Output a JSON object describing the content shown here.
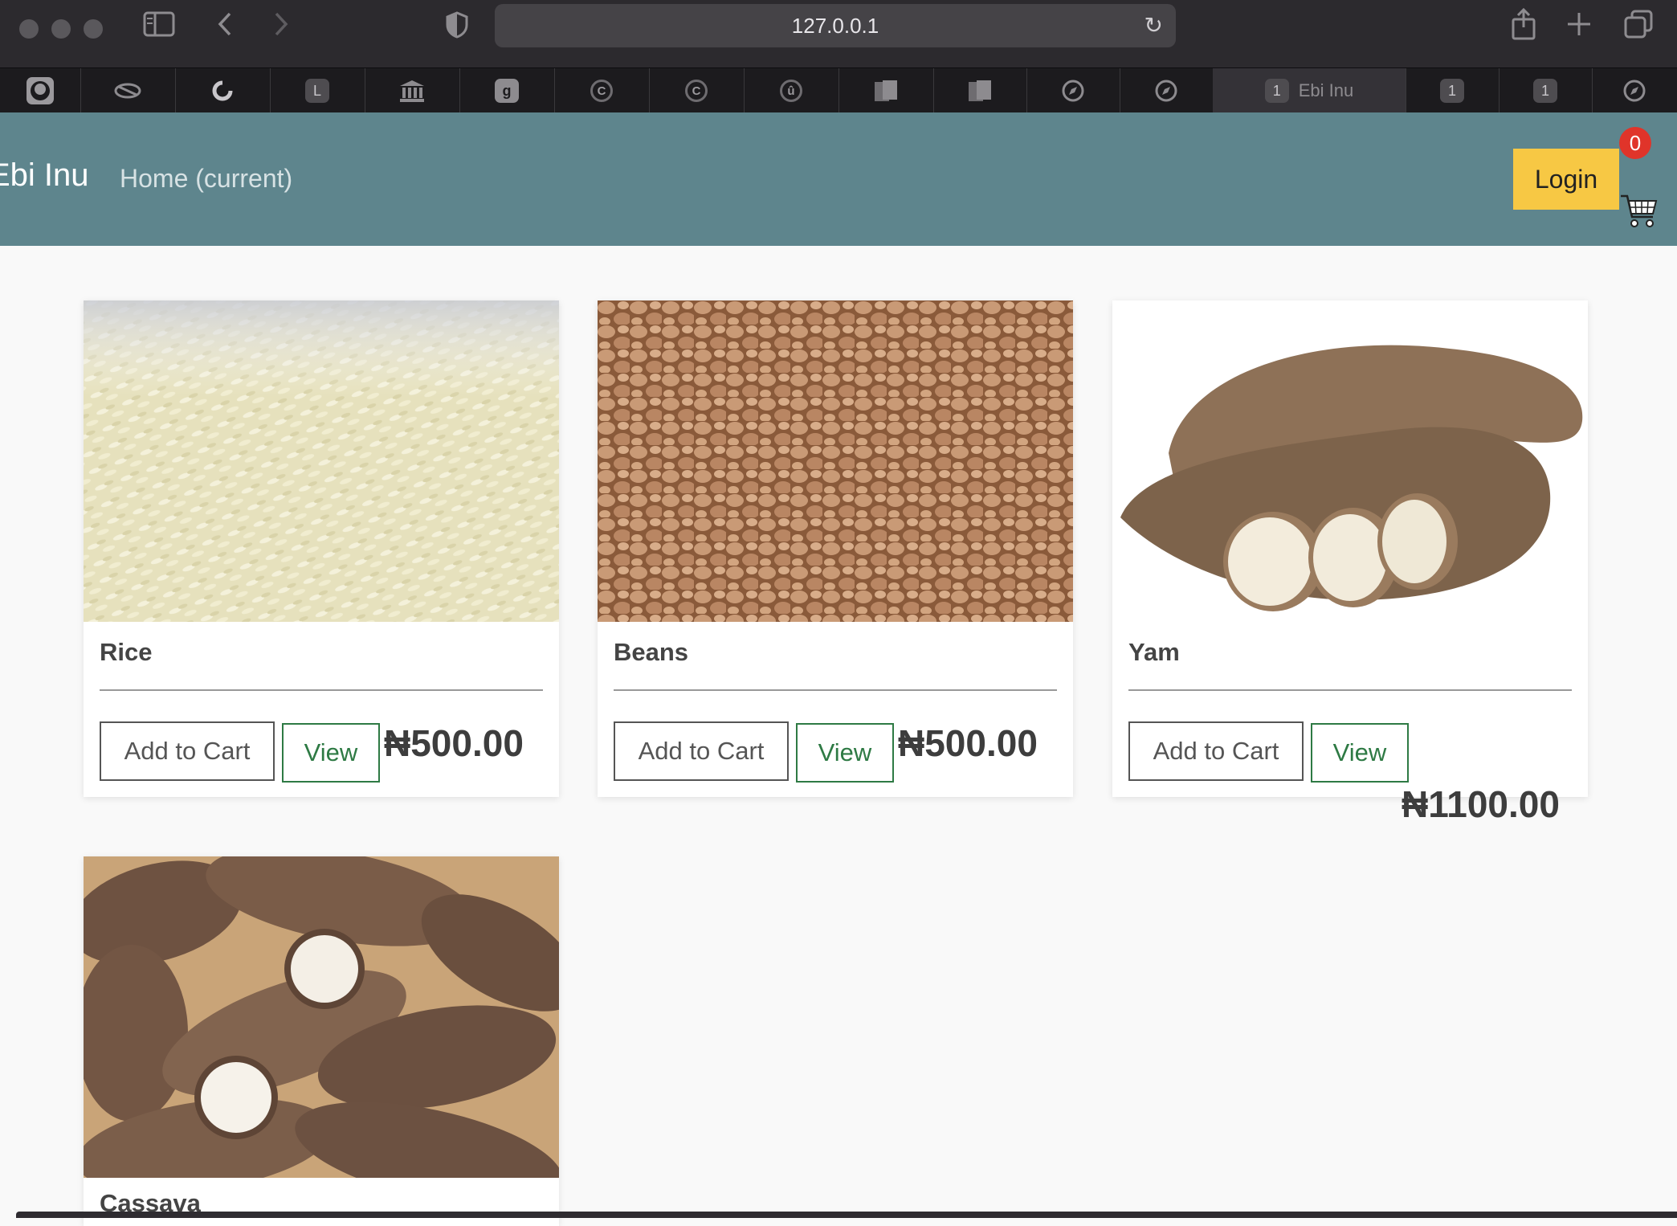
{
  "browser": {
    "url": "127.0.0.1",
    "tabs": [
      {
        "icon": "github-icon"
      },
      {
        "icon": "pill-icon"
      },
      {
        "icon": "circle-arrow-icon"
      },
      {
        "icon": "letter-l-icon",
        "glyph": "L"
      },
      {
        "icon": "bank-icon"
      },
      {
        "icon": "g-square-icon",
        "glyph": "g"
      },
      {
        "icon": "c-circle-icon",
        "glyph": "C"
      },
      {
        "icon": "c-circle-icon",
        "glyph": "C"
      },
      {
        "icon": "u-shield-icon",
        "glyph": "û"
      },
      {
        "icon": "pages-icon"
      },
      {
        "icon": "pages-icon"
      },
      {
        "icon": "compass-icon"
      },
      {
        "icon": "compass-icon"
      },
      {
        "icon": "tab-number-icon",
        "glyph": "1",
        "label": "Ebi Inu",
        "active": true
      },
      {
        "icon": "tab-number-icon",
        "glyph": "1"
      },
      {
        "icon": "tab-number-icon",
        "glyph": "1"
      },
      {
        "icon": "compass-icon"
      }
    ]
  },
  "navbar": {
    "brand": "Ebi Inu",
    "home_link": "Home (current)",
    "login_label": "Login",
    "cart_count": "0",
    "background": "#5e858d",
    "login_color": "#f7c844",
    "badge_color": "#e0342a"
  },
  "products": [
    {
      "name": "Rice",
      "add_label": "Add to Cart",
      "view_label": "View",
      "price": "₦500.00",
      "image": "rice-photo"
    },
    {
      "name": "Beans",
      "add_label": "Add to Cart",
      "view_label": "View",
      "price": "₦500.00",
      "image": "beans-photo"
    },
    {
      "name": "Yam",
      "add_label": "Add to Cart",
      "view_label": "View",
      "price": "₦1100.00",
      "image": "yam-photo"
    },
    {
      "name": "Cassava",
      "image": "cassava-photo"
    }
  ]
}
